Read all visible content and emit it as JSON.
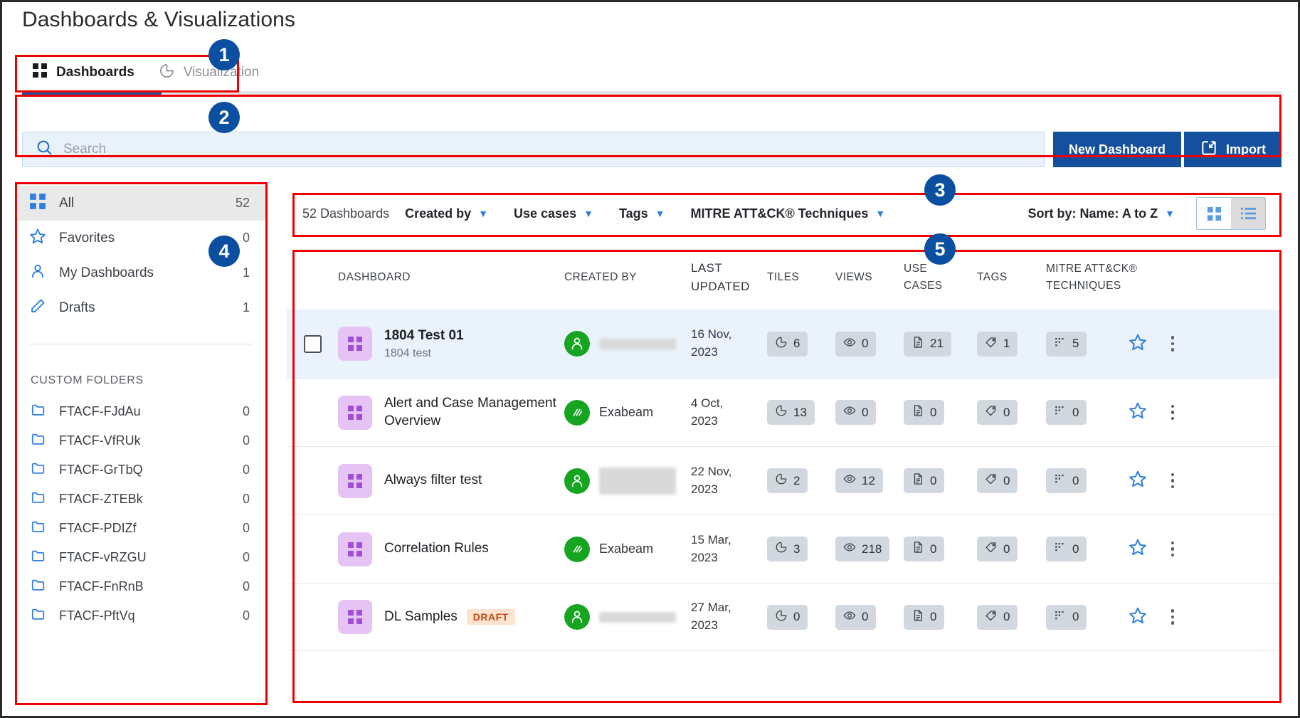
{
  "page": {
    "title": "Dashboards & Visualizations"
  },
  "tabs": [
    {
      "label": "Dashboards",
      "icon": "grid-icon",
      "active": true
    },
    {
      "label": "Visualization",
      "icon": "pie-chart-icon",
      "active": false
    }
  ],
  "search": {
    "placeholder": "Search",
    "value": "",
    "icon": "search-icon"
  },
  "actions": {
    "new_dashboard": "New Dashboard",
    "import": "Import",
    "import_icon": "import-icon"
  },
  "sidebar": {
    "items": [
      {
        "label": "All",
        "count": "52",
        "icon": "grid-icon",
        "selected": true
      },
      {
        "label": "Favorites",
        "count": "0",
        "icon": "star-icon",
        "selected": false
      },
      {
        "label": "My Dashboards",
        "count": "1",
        "icon": "person-icon",
        "selected": false
      },
      {
        "label": "Drafts",
        "count": "1",
        "icon": "pencil-icon",
        "selected": false
      }
    ],
    "custom_folders_header": "CUSTOM FOLDERS",
    "folders": [
      {
        "label": "FTACF-FJdAu",
        "count": "0"
      },
      {
        "label": "FTACF-VfRUk",
        "count": "0"
      },
      {
        "label": "FTACF-GrTbQ",
        "count": "0"
      },
      {
        "label": "FTACF-ZTEBk",
        "count": "0"
      },
      {
        "label": "FTACF-PDIZf",
        "count": "0"
      },
      {
        "label": "FTACF-vRZGU",
        "count": "0"
      },
      {
        "label": "FTACF-FnRnB",
        "count": "0"
      },
      {
        "label": "FTACF-PftVq",
        "count": "0"
      }
    ]
  },
  "filter_bar": {
    "count_label": "52 Dashboards",
    "dropdowns": [
      {
        "label": "Created by"
      },
      {
        "label": "Use cases"
      },
      {
        "label": "Tags"
      },
      {
        "label": "MITRE ATT&CK® Techniques"
      }
    ],
    "sort_label": "Sort by: Name: A to Z",
    "view_toggle": [
      {
        "name": "grid-view",
        "icon": "grid-icon",
        "active": false
      },
      {
        "name": "list-view",
        "icon": "list-icon",
        "active": true
      }
    ]
  },
  "table": {
    "columns": [
      {
        "label": "DASHBOARD"
      },
      {
        "label": "CREATED BY"
      },
      {
        "label": "LAST\nUPDATED"
      },
      {
        "label": "TILES"
      },
      {
        "label": "VIEWS"
      },
      {
        "label": "USE\nCASES"
      },
      {
        "label": "TAGS"
      },
      {
        "label": "MITRE ATT&CK®\nTECHNIQUES"
      }
    ],
    "rows": [
      {
        "name": "1804 Test 01",
        "subtitle": "1804 test",
        "badge": "",
        "created_by": "",
        "created_by_redacted": true,
        "avatar_icon": "person-icon",
        "last_updated": "16 Nov,\n2023",
        "tiles": "6",
        "views": "0",
        "use_cases": "21",
        "tags": "1",
        "mitre": "5",
        "selected": true,
        "checkbox": true
      },
      {
        "name": "Alert and Case Management Overview",
        "subtitle": "",
        "badge": "",
        "created_by": "Exabeam",
        "created_by_redacted": false,
        "avatar_icon": "exabeam-logo-icon",
        "last_updated": "4 Oct,\n2023",
        "tiles": "13",
        "views": "0",
        "use_cases": "0",
        "tags": "0",
        "mitre": "0",
        "selected": false,
        "checkbox": false
      },
      {
        "name": "Always filter test",
        "subtitle": "",
        "badge": "",
        "created_by": "",
        "created_by_redacted": true,
        "avatar_icon": "person-icon",
        "last_updated": "22 Nov,\n2023",
        "tiles": "2",
        "views": "12",
        "use_cases": "0",
        "tags": "0",
        "mitre": "0",
        "selected": false,
        "checkbox": false
      },
      {
        "name": "Correlation Rules",
        "subtitle": "",
        "badge": "",
        "created_by": "Exabeam",
        "created_by_redacted": false,
        "avatar_icon": "exabeam-logo-icon",
        "last_updated": "15 Mar,\n2023",
        "tiles": "3",
        "views": "218",
        "use_cases": "0",
        "tags": "0",
        "mitre": "0",
        "selected": false,
        "checkbox": false
      },
      {
        "name": "DL Samples",
        "subtitle": "",
        "badge": "DRAFT",
        "created_by": "",
        "created_by_redacted": true,
        "avatar_icon": "person-icon",
        "last_updated": "27 Mar,\n2023",
        "tiles": "0",
        "views": "0",
        "use_cases": "0",
        "tags": "0",
        "mitre": "0",
        "selected": false,
        "checkbox": false
      }
    ]
  },
  "annotations": [
    {
      "number": "1"
    },
    {
      "number": "2"
    },
    {
      "number": "3"
    },
    {
      "number": "4"
    },
    {
      "number": "5"
    }
  ],
  "colors": {
    "accent_blue": "#15509e",
    "annotation_navy": "#0b4fa0",
    "annotation_red": "#ef0000",
    "row_highlight": "#eaf2fb",
    "dash_icon_purple": "#e5c4f5",
    "avatar_green": "#16a520",
    "draft_badge_bg": "#fde3d0",
    "draft_badge_text": "#c24a12"
  }
}
